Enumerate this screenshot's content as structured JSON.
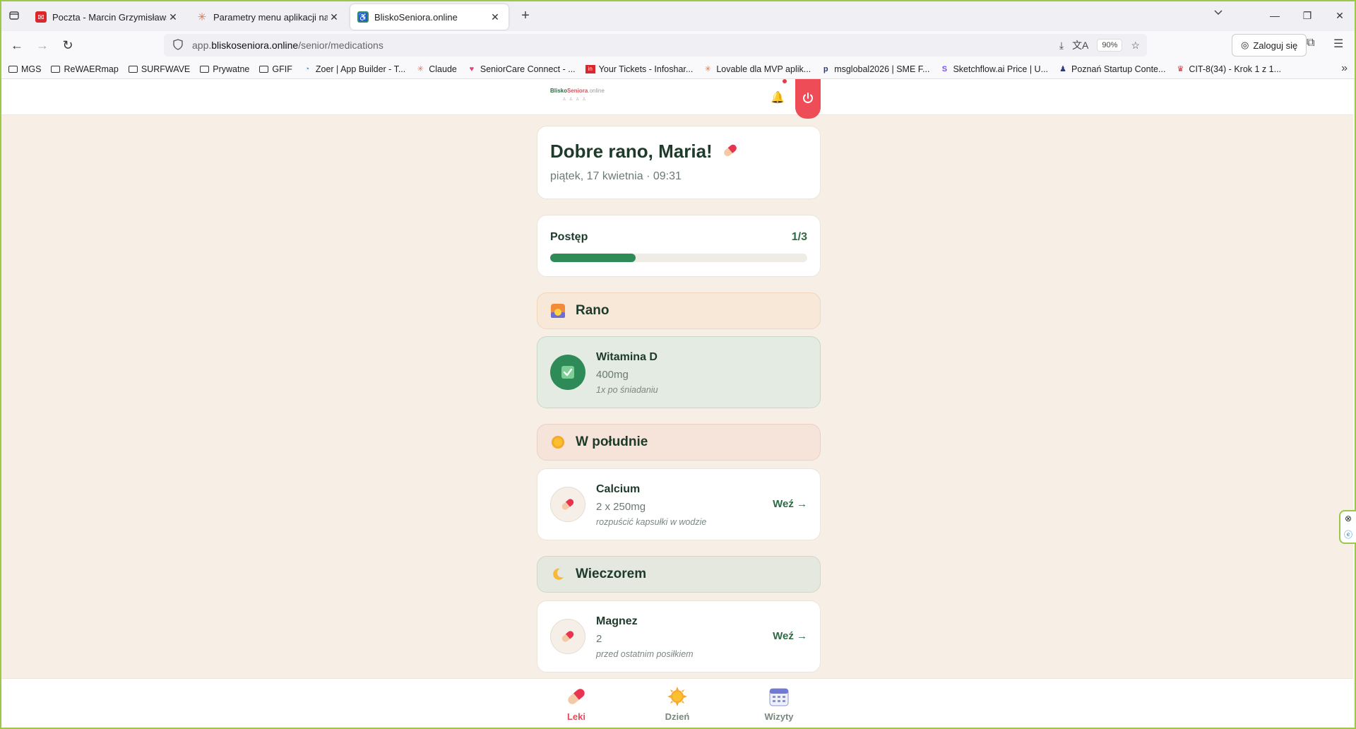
{
  "browser": {
    "tabs": [
      {
        "title": "Poczta - Marcin Grzymisławski -",
        "active": false,
        "favicon_color": "#d9272e"
      },
      {
        "title": "Parametry menu aplikacji na Lov",
        "active": false,
        "favicon_color": "#d97757"
      },
      {
        "title": "BliskoSeniora.online",
        "active": true,
        "favicon_color": "#3a8f6a"
      }
    ],
    "url_prefix": "app.",
    "url_domain": "bliskoseniora.online",
    "url_path": "/senior/medications",
    "zoom": "90%",
    "login_label": "Zaloguj się",
    "bookmarks": [
      {
        "label": "MGS",
        "icon": "folder-icon"
      },
      {
        "label": "ReWAERmap",
        "icon": "folder-icon"
      },
      {
        "label": "SURFWAVE",
        "icon": "folder-icon"
      },
      {
        "label": "Prywatne",
        "icon": "folder-icon"
      },
      {
        "label": "GFIF",
        "icon": "folder-icon"
      },
      {
        "label": "Zoer | App Builder - T...",
        "icon": "zoer-icon"
      },
      {
        "label": "Claude",
        "icon": "claude-icon"
      },
      {
        "label": "SeniorCare Connect - ...",
        "icon": "heart-icon"
      },
      {
        "label": "Your Tickets - Infoshar...",
        "icon": "ticket-icon"
      },
      {
        "label": "Lovable dla MVP aplik...",
        "icon": "claude-icon"
      },
      {
        "label": "msglobal2026 | SME F...",
        "icon": "doc-icon"
      },
      {
        "label": "Sketchflow.ai Price | U...",
        "icon": "sketch-icon"
      },
      {
        "label": "Poznań Startup Conte...",
        "icon": "startup-icon"
      },
      {
        "label": "CIT-8(34) -  Krok 1 z 1...",
        "icon": "gov-icon"
      }
    ]
  },
  "app": {
    "logo_part1": "Blisko",
    "logo_part2": "Seniora",
    "logo_part3": ".online",
    "greeting": "Dobre rano, Maria!",
    "date_line": "piątek, 17 kwietnia · 09:31",
    "progress": {
      "label": "Postęp",
      "count": "1/3",
      "fraction": 0.333
    },
    "sections": [
      {
        "title": "Rano",
        "icon": "sunrise-icon",
        "meds": [
          {
            "name": "Witamina D",
            "dose": "400mg",
            "note": "1x po śniadaniu",
            "taken": true
          }
        ]
      },
      {
        "title": "W południe",
        "icon": "sun-icon",
        "meds": [
          {
            "name": "Calcium",
            "dose": "2 x 250mg",
            "note": "rozpuścić kapsułki w wodzie",
            "taken": false,
            "action": "Weź →"
          }
        ]
      },
      {
        "title": "Wieczorem",
        "icon": "moon-icon",
        "meds": [
          {
            "name": "Magnez",
            "dose": "2",
            "note": "przed ostatnim posiłkiem",
            "taken": false,
            "action": "Weź →"
          }
        ]
      }
    ],
    "bottom_nav": [
      {
        "label": "Leki",
        "icon": "pill-icon",
        "active": true
      },
      {
        "label": "Dzień",
        "icon": "sun-icon",
        "active": false
      },
      {
        "label": "Wizyty",
        "icon": "calendar-icon",
        "active": false
      }
    ]
  }
}
